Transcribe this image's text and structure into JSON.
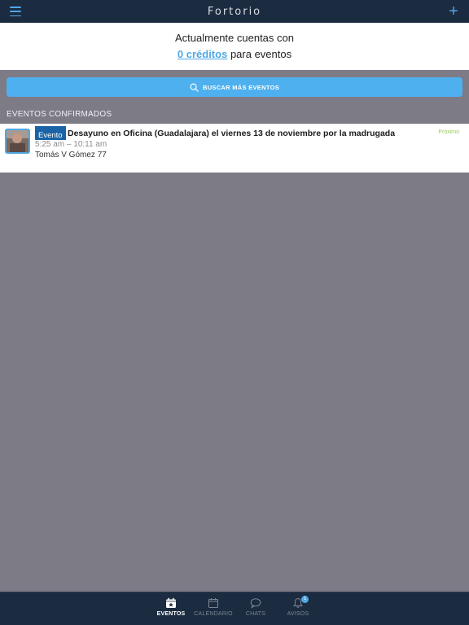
{
  "app": {
    "title": "Fortorio"
  },
  "credits": {
    "prefix": "Actualmente cuentas con",
    "amount_link": "0 créditos",
    "suffix": "para eventos"
  },
  "search": {
    "label": "BUSCAR MÁS EVENTOS"
  },
  "sections": {
    "confirmed_title": "EVENTOS CONFIRMADOS"
  },
  "events": [
    {
      "badge": "Evento",
      "title": "Desayuno en Oficina (Guadalajara) el viernes 13 de noviembre por la madrugada",
      "status": "Próximo",
      "time": "5:25 am – 10:11 am",
      "organizer": "Tomás V Gómez 77"
    }
  ],
  "tabs": [
    {
      "label": "EVENTOS",
      "icon": "calendar-star-icon",
      "active": true
    },
    {
      "label": "CALENDARIO",
      "icon": "calendar-icon",
      "active": false
    },
    {
      "label": "CHATS",
      "icon": "chat-bubble-icon",
      "active": false
    },
    {
      "label": "AVISOS",
      "icon": "bell-icon",
      "active": false,
      "badge": "1"
    }
  ],
  "colors": {
    "header_bg": "#1b2b40",
    "accent": "#4fa8e6",
    "page_bg": "#7c7b86",
    "badge_bg": "#1a63a6",
    "status_green": "#9acb64"
  }
}
